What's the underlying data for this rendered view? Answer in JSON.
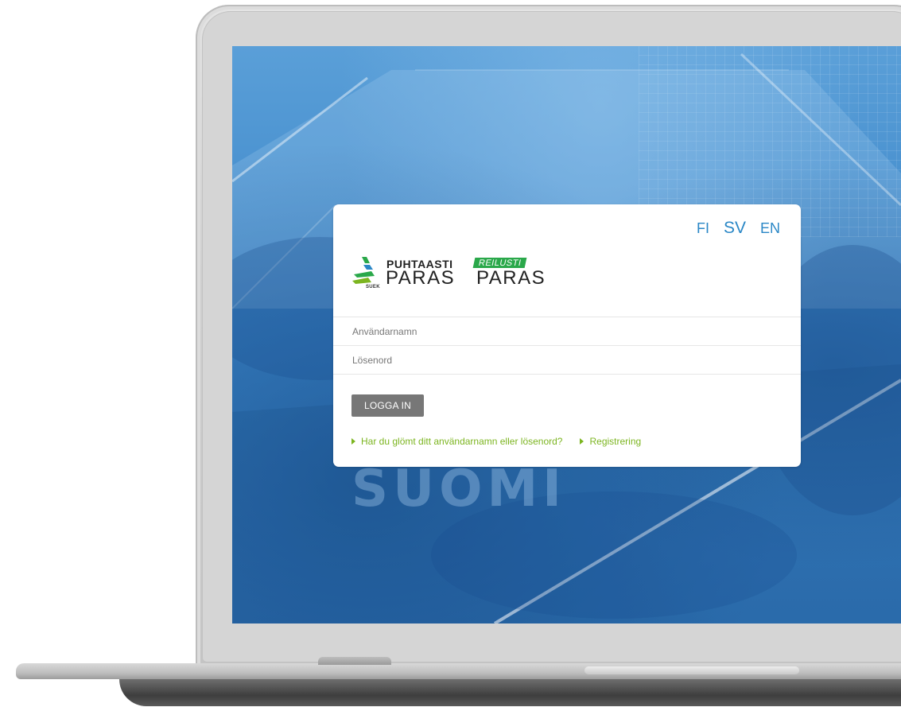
{
  "languages": [
    {
      "code": "FI",
      "active": false
    },
    {
      "code": "SV",
      "active": true
    },
    {
      "code": "EN",
      "active": false
    }
  ],
  "logo": {
    "suek": "SUEK",
    "puhtaasti": "PUHTAASTI",
    "paras": "PARAS",
    "reilusti": "REILUSTI",
    "paras2": "PARAS"
  },
  "form": {
    "username_placeholder": "Användarnamn",
    "username_value": "",
    "password_placeholder": "Lösenord",
    "password_value": "",
    "login_label": "LOGGA IN"
  },
  "links": {
    "forgot": "Har du glömt ditt användarnamn eller lösenord?",
    "register": "Registrering"
  },
  "background": {
    "shirt_text": "SUOMI"
  },
  "colors": {
    "language_link": "#2a87c6",
    "link_green": "#7cb520",
    "login_button": "#777777",
    "background_blue": "#3c86c8",
    "reilusti_green": "#2aa84a"
  }
}
